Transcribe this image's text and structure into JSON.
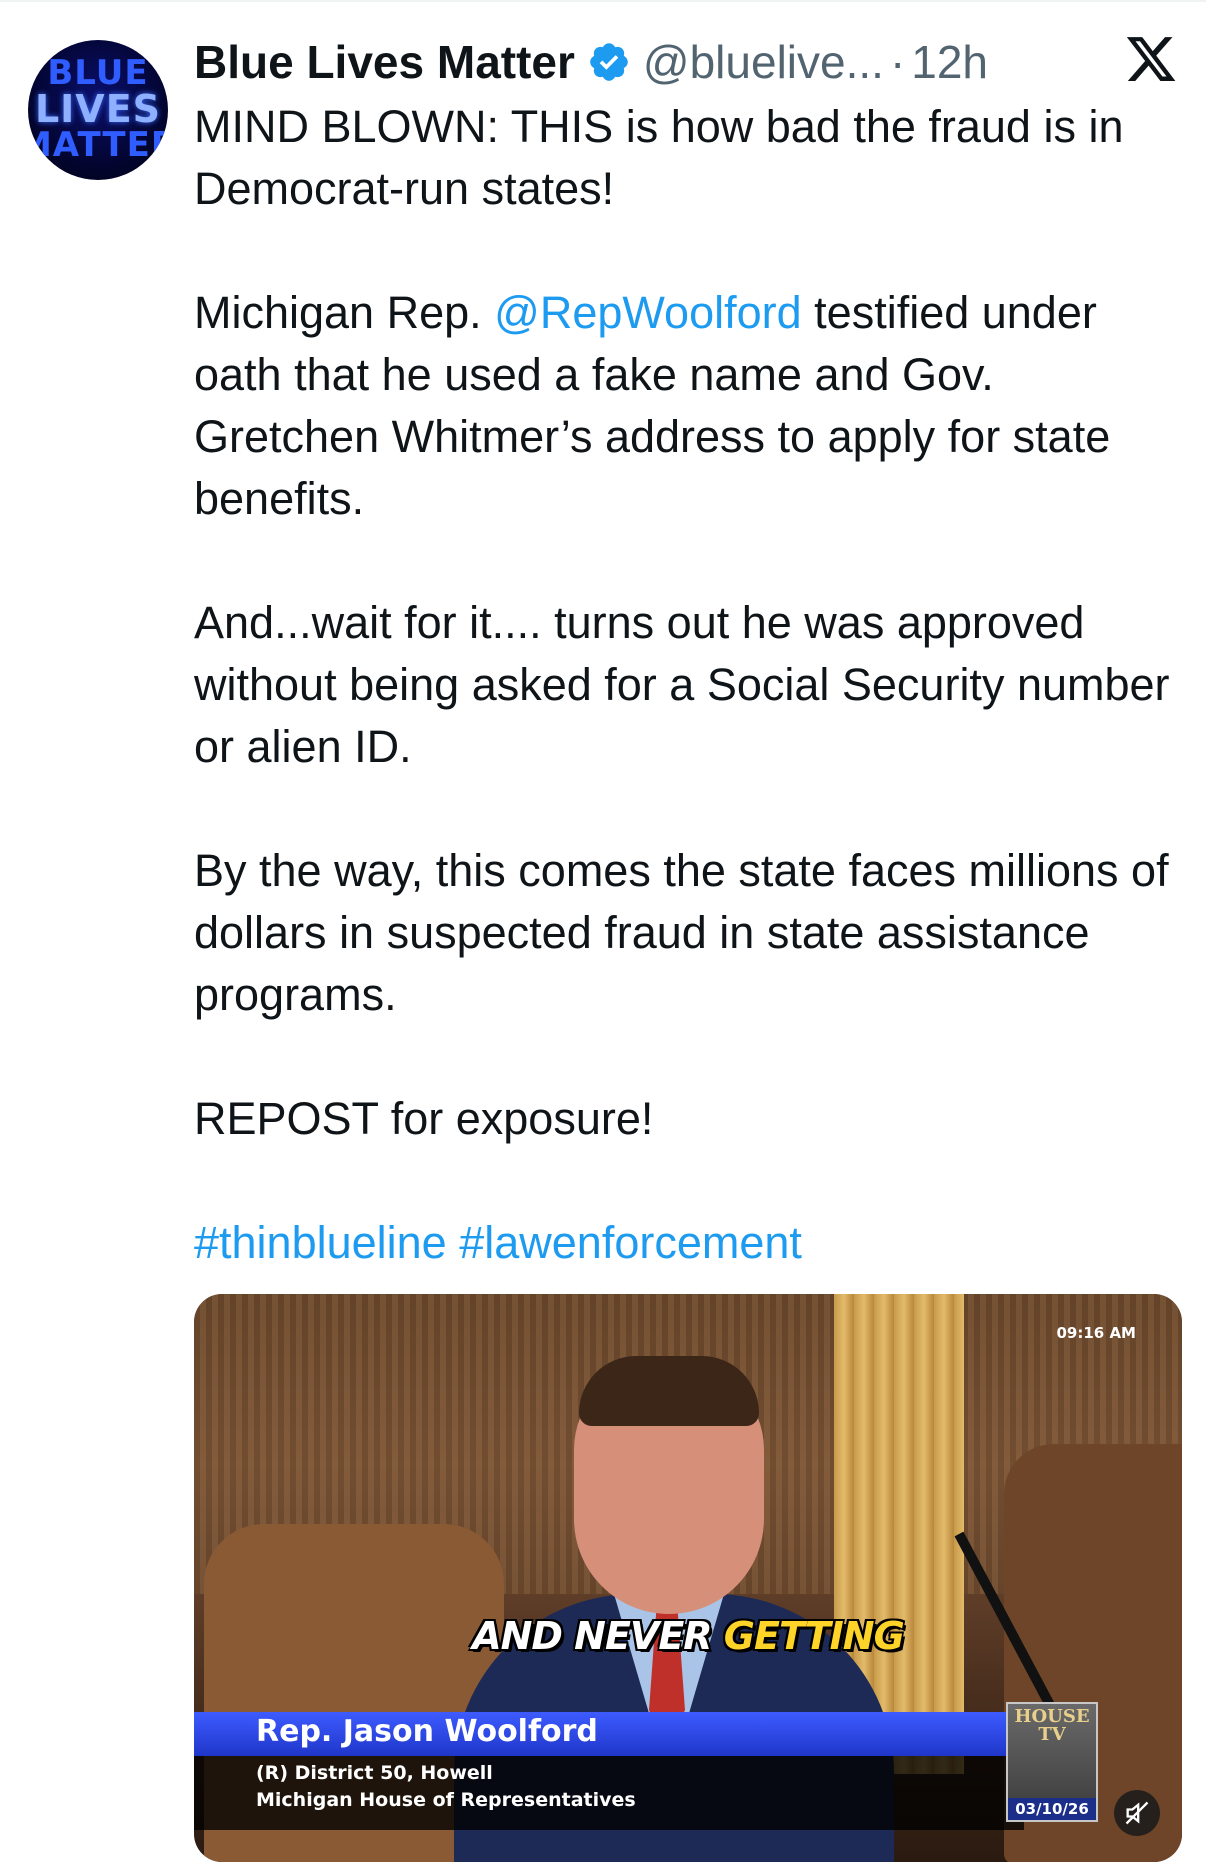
{
  "tweet": {
    "display_name": "Blue Lives Matter",
    "handle": "@bluelive...",
    "separator": "·",
    "time": "12h",
    "avatar_text": [
      "BLUE",
      "LIVES",
      "MATTER"
    ],
    "paragraphs": {
      "p1": "MIND BLOWN: THIS is how bad the fraud is in Democrat-run states!",
      "p2_before": "Michigan Rep. ",
      "p2_mention": "@RepWoolford",
      "p2_after": " testified under oath that he used a fake name and Gov. Gretchen Whitmer’s address to apply for state benefits.",
      "p3": "And...wait for it.... turns out he was approved without being asked for a Social Security number or alien ID.",
      "p4": "By the way, this comes the state faces millions of dollars in suspected fraud in state assistance programs.",
      "p5": "REPOST for exposure!",
      "hashtag1": "#thinblueline",
      "hashtag2": "#lawenforcement"
    }
  },
  "video": {
    "timestamp": "09:16 AM",
    "caption_white": "AND NEVER ",
    "caption_yellow": "GETTING",
    "name": "Rep. Jason Woolford",
    "district": "(R) District 50, Howell",
    "chamber": "Michigan House of Representatives",
    "housetv_line1": "HOUSE",
    "housetv_line2": "TV",
    "date": "03/10/26"
  },
  "icons": {
    "verified": "verified-badge-icon",
    "platform": "x-logo-icon",
    "mute": "muted-speaker-icon"
  },
  "colors": {
    "link": "#1d9bf0",
    "text": "#0f1419",
    "secondary": "#536471",
    "lower_third_blue": "#1f36c9"
  }
}
